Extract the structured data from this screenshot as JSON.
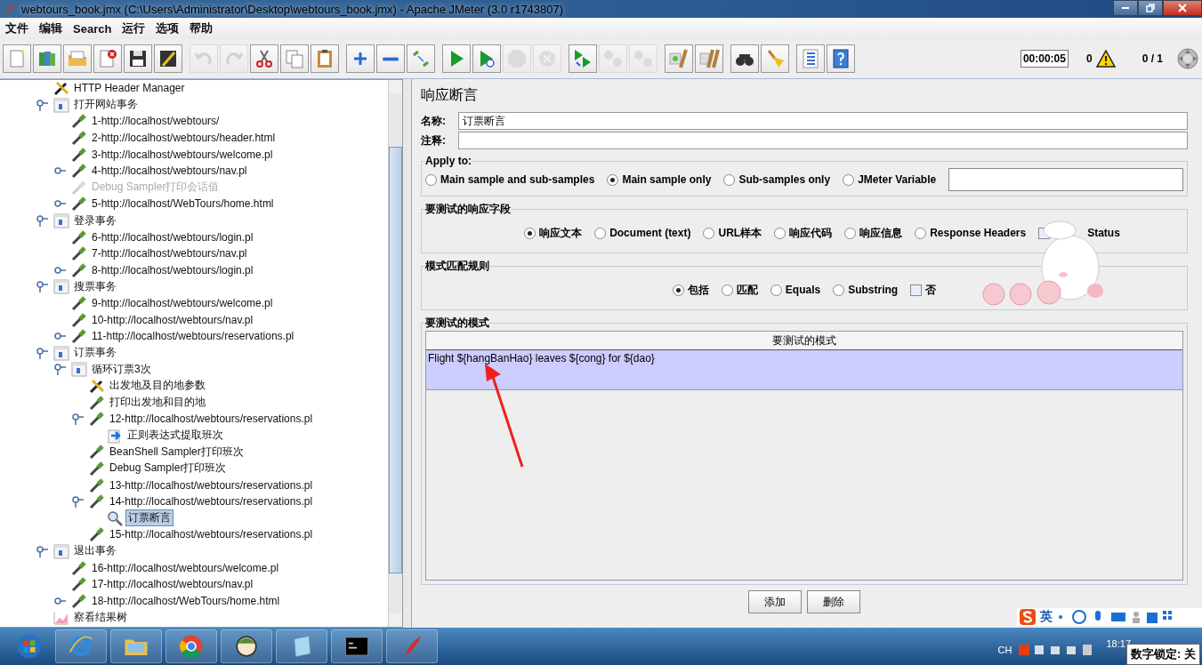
{
  "window": {
    "title": "webtours_book.jmx (C:\\Users\\Administrator\\Desktop\\webtours_book.jmx) - Apache JMeter (3.0 r1743807)"
  },
  "menu": [
    "文件",
    "编辑",
    "Search",
    "运行",
    "选项",
    "帮助"
  ],
  "toolbar": [
    [
      {
        "kind": "new",
        "disabled": false
      },
      {
        "kind": "templates",
        "disabled": false
      },
      {
        "kind": "open",
        "disabled": false
      },
      {
        "kind": "close",
        "disabled": false
      },
      {
        "kind": "save",
        "disabled": false
      },
      {
        "kind": "save-edit",
        "disabled": false
      }
    ],
    [
      {
        "kind": "undo",
        "disabled": true
      },
      {
        "kind": "redo",
        "disabled": true
      },
      {
        "kind": "cut",
        "disabled": false
      },
      {
        "kind": "copy",
        "disabled": false
      },
      {
        "kind": "paste",
        "disabled": false
      }
    ],
    [
      {
        "kind": "expand",
        "disabled": false
      },
      {
        "kind": "collapse",
        "disabled": false
      },
      {
        "kind": "toggle",
        "disabled": false
      }
    ],
    [
      {
        "kind": "start",
        "disabled": false
      },
      {
        "kind": "start-no-pause",
        "disabled": false
      },
      {
        "kind": "stop",
        "disabled": true
      },
      {
        "kind": "shutdown",
        "disabled": true
      }
    ],
    [
      {
        "kind": "remote-start",
        "disabled": false
      },
      {
        "kind": "remote-stop",
        "disabled": true
      },
      {
        "kind": "remote-shutdown",
        "disabled": true
      }
    ],
    [
      {
        "kind": "clear",
        "disabled": false
      },
      {
        "kind": "clear-all",
        "disabled": false
      }
    ],
    [
      {
        "kind": "search",
        "disabled": false
      },
      {
        "kind": "reset",
        "disabled": false
      }
    ],
    [
      {
        "kind": "functions",
        "disabled": false
      },
      {
        "kind": "help",
        "disabled": false
      }
    ]
  ],
  "status": {
    "elapsed": "00:00:05",
    "warnings": "0",
    "threads": "0 / 1"
  },
  "tree": [
    {
      "label": "HTTP Header Manager",
      "kind": "config",
      "selected": false,
      "disabled": false
    },
    {
      "label": "打开网站事务",
      "kind": "transaction",
      "selected": false,
      "disabled": false,
      "expanded": true,
      "children": [
        {
          "label": "1-http://localhost/webtours/",
          "kind": "sampler",
          "selected": false,
          "disabled": false
        },
        {
          "label": "2-http://localhost/webtours/header.html",
          "kind": "sampler",
          "selected": false,
          "disabled": false
        },
        {
          "label": "3-http://localhost/webtours/welcome.pl",
          "kind": "sampler",
          "selected": false,
          "disabled": false
        },
        {
          "label": "4-http://localhost/webtours/nav.pl",
          "kind": "sampler",
          "selected": false,
          "disabled": false,
          "expanded": false
        },
        {
          "label": "Debug Sampler打印会话值",
          "kind": "sampler",
          "selected": false,
          "disabled": true
        },
        {
          "label": "5-http://localhost/WebTours/home.html",
          "kind": "sampler",
          "selected": false,
          "disabled": false,
          "expanded": false
        }
      ]
    },
    {
      "label": "登录事务",
      "kind": "transaction",
      "selected": false,
      "disabled": false,
      "expanded": true,
      "children": [
        {
          "label": "6-http://localhost/webtours/login.pl",
          "kind": "sampler",
          "selected": false,
          "disabled": false
        },
        {
          "label": "7-http://localhost/webtours/nav.pl",
          "kind": "sampler",
          "selected": false,
          "disabled": false
        },
        {
          "label": "8-http://localhost/webtours/login.pl",
          "kind": "sampler",
          "selected": false,
          "disabled": false,
          "expanded": false
        }
      ]
    },
    {
      "label": "搜票事务",
      "kind": "transaction",
      "selected": false,
      "disabled": false,
      "expanded": true,
      "children": [
        {
          "label": "9-http://localhost/webtours/welcome.pl",
          "kind": "sampler",
          "selected": false,
          "disabled": false
        },
        {
          "label": "10-http://localhost/webtours/nav.pl",
          "kind": "sampler",
          "selected": false,
          "disabled": false
        },
        {
          "label": "11-http://localhost/webtours/reservations.pl",
          "kind": "sampler",
          "selected": false,
          "disabled": false,
          "expanded": false
        }
      ]
    },
    {
      "label": "订票事务",
      "kind": "transaction",
      "selected": false,
      "disabled": false,
      "expanded": true,
      "children": [
        {
          "label": "循环订票3次",
          "kind": "transaction",
          "selected": false,
          "disabled": false,
          "expanded": true,
          "children": [
            {
              "label": "出发地及目的地参数",
              "kind": "config",
              "selected": false,
              "disabled": false
            },
            {
              "label": "打印出发地和目的地",
              "kind": "sampler",
              "selected": false,
              "disabled": false
            },
            {
              "label": "12-http://localhost/webtours/reservations.pl",
              "kind": "sampler",
              "selected": false,
              "disabled": false,
              "expanded": true,
              "children": [
                {
                  "label": "正则表达式提取班次",
                  "kind": "extractor",
                  "selected": false,
                  "disabled": false
                }
              ]
            },
            {
              "label": "BeanShell Sampler打印班次",
              "kind": "sampler",
              "selected": false,
              "disabled": false
            },
            {
              "label": "Debug Sampler打印班次",
              "kind": "sampler",
              "selected": false,
              "disabled": false
            },
            {
              "label": "13-http://localhost/webtours/reservations.pl",
              "kind": "sampler",
              "selected": false,
              "disabled": false
            },
            {
              "label": "14-http://localhost/webtours/reservations.pl",
              "kind": "sampler",
              "selected": false,
              "disabled": false,
              "expanded": true,
              "children": [
                {
                  "label": "订票断言",
                  "kind": "assertion",
                  "selected": true,
                  "disabled": false
                }
              ]
            },
            {
              "label": "15-http://localhost/webtours/reservations.pl",
              "kind": "sampler",
              "selected": false,
              "disabled": false
            }
          ]
        }
      ]
    },
    {
      "label": "退出事务",
      "kind": "transaction",
      "selected": false,
      "disabled": false,
      "expanded": true,
      "children": [
        {
          "label": "16-http://localhost/webtours/welcome.pl",
          "kind": "sampler",
          "selected": false,
          "disabled": false
        },
        {
          "label": "17-http://localhost/webtours/nav.pl",
          "kind": "sampler",
          "selected": false,
          "disabled": false
        },
        {
          "label": "18-http://localhost/WebTours/home.html",
          "kind": "sampler",
          "selected": false,
          "disabled": false,
          "expanded": false
        }
      ]
    },
    {
      "label": "察看结果树",
      "kind": "listener",
      "selected": false,
      "disabled": false
    }
  ],
  "panel": {
    "title": "响应断言",
    "name_label": "名称:",
    "name_value": "订票断言",
    "comment_label": "注释:",
    "apply_to": {
      "legend": "Apply to:",
      "options": [
        {
          "label": "Main sample and sub-samples",
          "selected": false
        },
        {
          "label": "Main sample only",
          "selected": true
        },
        {
          "label": "Sub-samples only",
          "selected": false
        },
        {
          "label": "JMeter Variable",
          "selected": false
        }
      ]
    },
    "response_field": {
      "legend": "要测试的响应字段",
      "options": [
        {
          "label": "响应文本",
          "selected": true
        },
        {
          "label": "Document (text)",
          "selected": false
        },
        {
          "label": "URL样本",
          "selected": false
        },
        {
          "label": "响应代码",
          "selected": false
        },
        {
          "label": "响应信息",
          "selected": false
        },
        {
          "label": "Response Headers",
          "selected": false
        }
      ],
      "ignore_status": {
        "label": "Status",
        "checked": false
      }
    },
    "pattern_rules": {
      "legend": "模式匹配规则",
      "options": [
        {
          "label": "包括",
          "selected": true
        },
        {
          "label": "匹配",
          "selected": false
        },
        {
          "label": "Equals",
          "selected": false
        },
        {
          "label": "Substring",
          "selected": false
        }
      ],
      "not": {
        "label": "否",
        "checked": false
      }
    },
    "patterns": {
      "legend": "要测试的模式",
      "column": "要测试的模式",
      "rows": [
        {
          "text": "Flight ${hangBanHao} leaves ${cong}  for ${dao}",
          "selected": true
        }
      ]
    },
    "buttons": [
      "添加",
      "删除"
    ]
  },
  "ime": {
    "label": "英"
  },
  "taskbar": {
    "apps": [
      {
        "kind": "start"
      },
      {
        "kind": "ie"
      },
      {
        "kind": "explorer"
      },
      {
        "kind": "chrome"
      },
      {
        "kind": "avatar"
      },
      {
        "kind": "notepad"
      },
      {
        "kind": "cmd"
      },
      {
        "kind": "jmeter"
      }
    ],
    "lang": "CH",
    "time": "18:17",
    "tooltip": "数字锁定: 关"
  }
}
